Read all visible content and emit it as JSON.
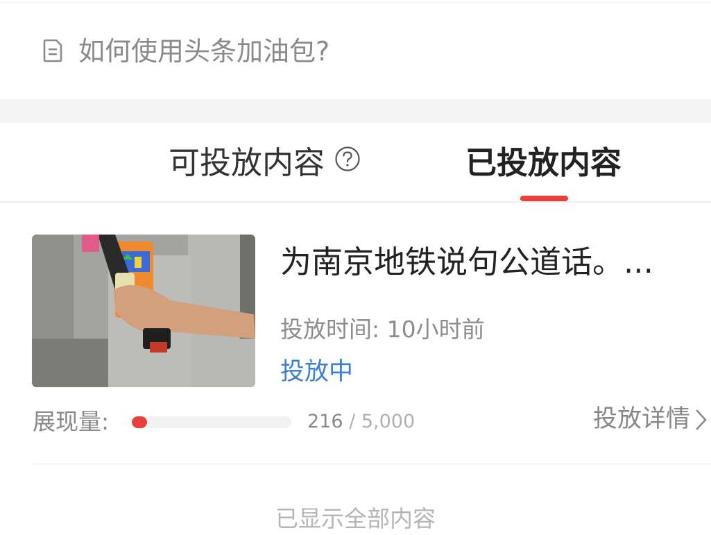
{
  "faq": {
    "text": "如何使用头条加油包?",
    "icon": "document-icon"
  },
  "tabs": [
    {
      "label": "可投放内容",
      "active": false,
      "icon": "question-circle-icon"
    },
    {
      "label": "已投放内容",
      "active": true
    }
  ],
  "colors": {
    "accent": "#e8413b",
    "status": "#3a7ed6",
    "muted": "#888888"
  },
  "item": {
    "title": "为南京地铁说句公道话。...",
    "time": "投放时间: 10小时前",
    "status": "投放中",
    "impressions_label": "展现量:",
    "impressions": "216",
    "impressions_slash": "/",
    "impressions_total": "5,000",
    "progress_fraction": 0.0432,
    "details_label": "投放详情",
    "details_icon": "chevron-right-icon"
  },
  "footer": {
    "text": "已显示全部内容"
  }
}
